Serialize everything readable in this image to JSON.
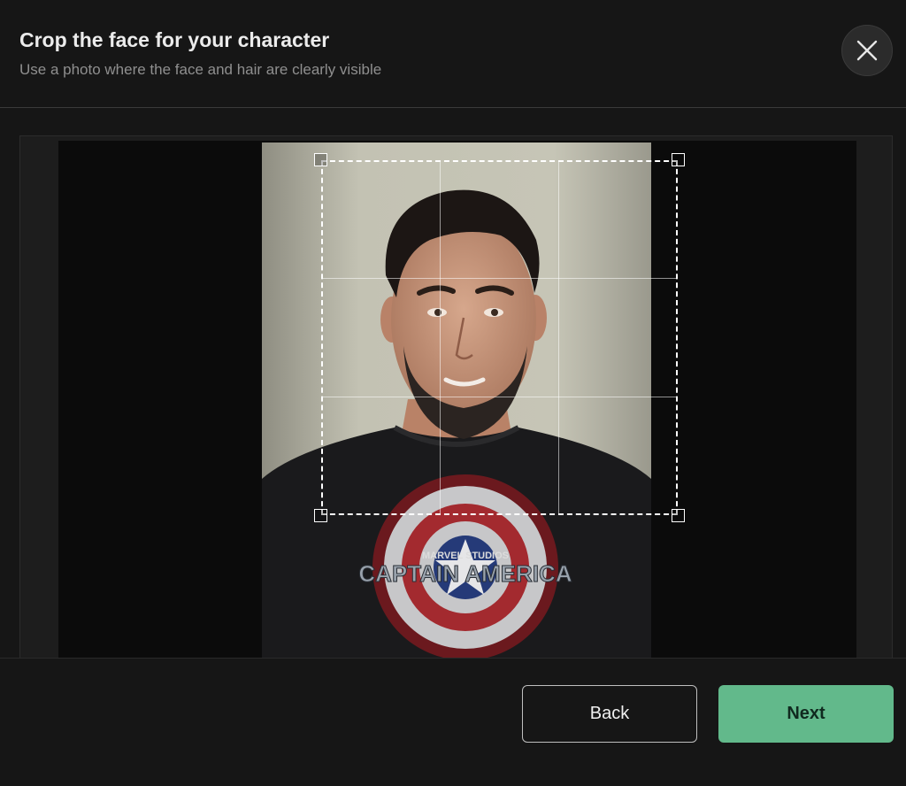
{
  "header": {
    "title": "Crop the face for your character",
    "subtitle": "Use a photo where the face and hair are clearly visible",
    "close_icon": "close-icon"
  },
  "photo": {
    "shirt_brand": "MARVEL STUDIOS",
    "shirt_logo": "CAPTAIN AMERICA"
  },
  "footer": {
    "back_label": "Back",
    "next_label": "Next",
    "next_color": "#62b98b"
  }
}
